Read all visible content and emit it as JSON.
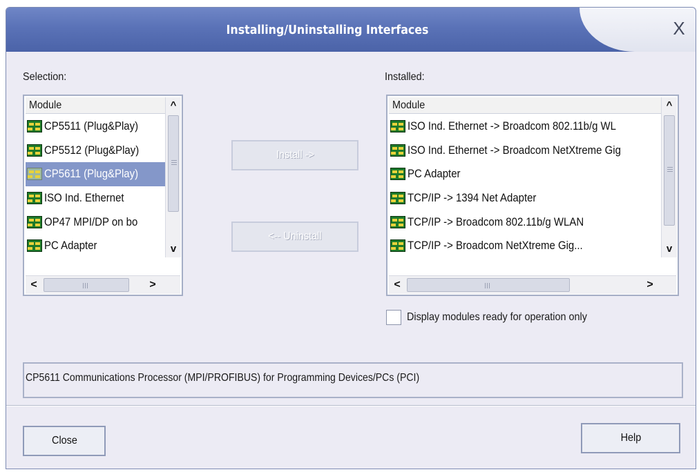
{
  "window": {
    "title": "Installing/Uninstalling Interfaces",
    "close_glyph": "X",
    "colors": {
      "titlebar": "#5a72b7",
      "dialog_bg": "#ecebf4",
      "selection": "#8497c9"
    }
  },
  "selection": {
    "label": "Selection:",
    "column_header": "Module",
    "items": [
      {
        "label": "CP5511 (Plug&Play)",
        "icon": "module-chip-icon"
      },
      {
        "label": "CP5512 (Plug&Play)",
        "icon": "module-chip-icon"
      },
      {
        "label": "CP5611 (Plug&Play)",
        "icon": "module-chip-icon",
        "selected": true
      },
      {
        "label": "ISO Ind. Ethernet",
        "icon": "module-chip-icon"
      },
      {
        "label": "OP47 MPI/DP on bo",
        "icon": "module-chip-icon"
      },
      {
        "label": "PC Adapter",
        "icon": "module-chip-icon"
      }
    ]
  },
  "installed": {
    "label": "Installed:",
    "column_header": "Module",
    "items": [
      {
        "label": "ISO Ind. Ethernet -> Broadcom 802.11b/g WL",
        "icon": "module-chip-icon"
      },
      {
        "label": "ISO Ind. Ethernet -> Broadcom NetXtreme Gig",
        "icon": "module-chip-icon"
      },
      {
        "label": "PC Adapter",
        "icon": "module-chip-icon"
      },
      {
        "label": "TCP/IP -> 1394 Net Adapter",
        "icon": "module-chip-icon"
      },
      {
        "label": "TCP/IP -> Broadcom 802.11b/g WLAN",
        "icon": "module-chip-icon"
      },
      {
        "label": "TCP/IP -> Broadcom NetXtreme Gig...",
        "icon": "module-chip-icon"
      }
    ]
  },
  "buttons": {
    "install": "Install ->",
    "uninstall": "<-- Uninstall",
    "close": "Close",
    "help": "Help"
  },
  "options": {
    "ready_only_label": "Display modules ready for operation only",
    "ready_only_checked": false
  },
  "description": "CP5611 Communications Processor (MPI/PROFIBUS) for Programming Devices/PCs (PCI)",
  "scroll_glyphs": {
    "up": "^",
    "down": "v",
    "left": "<",
    "right": ">",
    "grip_v": "≡",
    "grip_h": "III"
  }
}
